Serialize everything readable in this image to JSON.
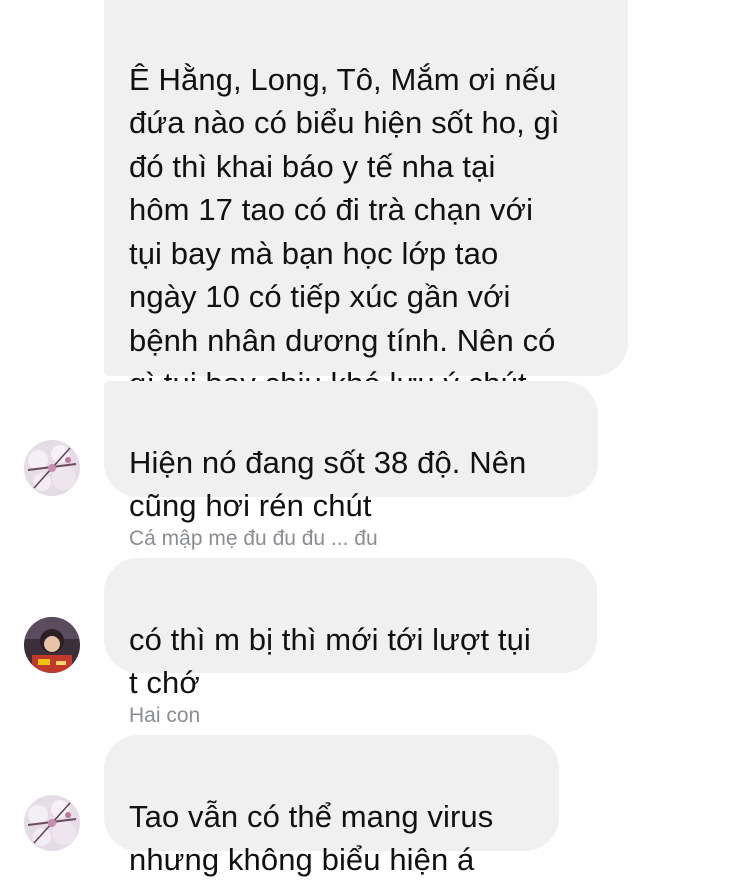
{
  "messages": [
    {
      "text": "Ê Hằng, Long, Tô, Mắm ơi nếu\nđứa nào có biểu hiện sốt ho, gì\nđó thì khai báo y tế nha tại\nhôm 17 tao có đi trà chạn với\ntụi bay mà bạn học lớp tao\nngày 10 có tiếp xúc gần với\nbệnh nhân dương tính. Nên có\ngì tụi bay chịu khó lưu ý chút."
    },
    {
      "text": "Hiện nó đang sốt 38 độ. Nên\ncũng hơi rén chút"
    },
    {
      "sender": "Cá mập mẹ đu đu đu ... đu",
      "text": "có thì m bị thì mới tới lượt tụi\nt chớ"
    },
    {
      "sender": "Hai con",
      "text": "Tao vẫn có thể mang virus\nnhưng không biểu hiện á"
    }
  ],
  "colors": {
    "bubble": "#f0f0f1",
    "sender_text": "#8a8d91",
    "message_text": "#111111"
  }
}
